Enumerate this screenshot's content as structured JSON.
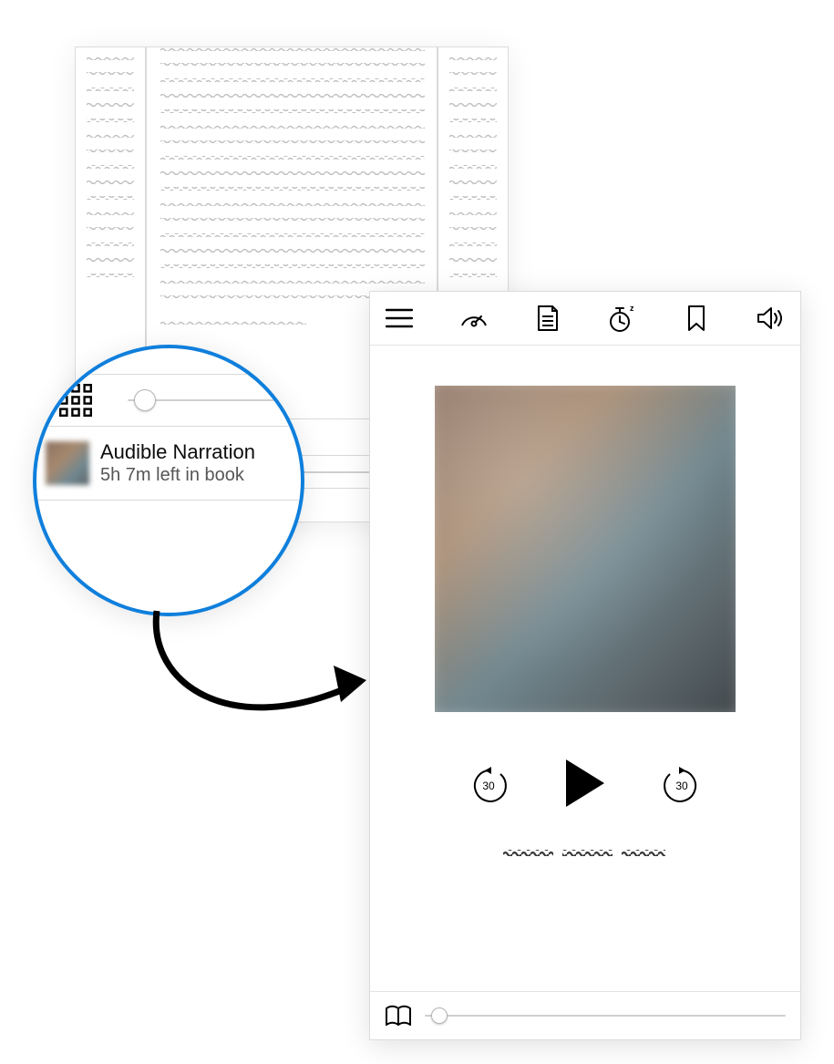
{
  "callout": {
    "title": "Audible Narration",
    "subtitle": "5h 7m left in book",
    "slider_position_pct": 10
  },
  "reader": {
    "progress_slider_pct": 18
  },
  "player": {
    "toolbar": {
      "menu": "menu",
      "speed": "speed",
      "chapters": "chapters",
      "sleep_timer": "sleep-timer",
      "bookmark": "bookmark",
      "volume": "volume"
    },
    "controls": {
      "skip_back_seconds": "30",
      "skip_forward_seconds": "30"
    },
    "progress_slider_pct": 4
  },
  "colors": {
    "accent_blue": "#0f7fdc"
  }
}
